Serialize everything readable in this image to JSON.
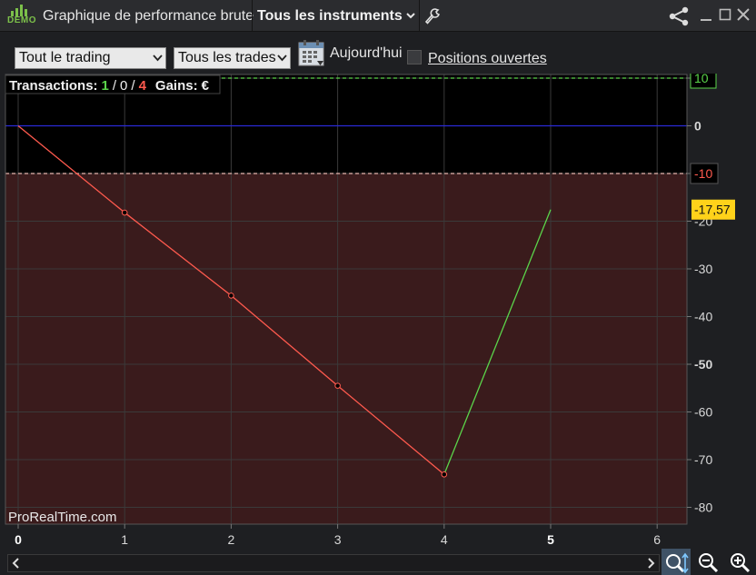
{
  "window": {
    "logo_text": "DEMO",
    "title": "Graphique de performance brute",
    "instrument": "Tous les instruments"
  },
  "toolbar": {
    "filter_trading": "Tout le trading",
    "filter_trades": "Tous les trades",
    "date_label": "Aujourd'hui",
    "open_positions_label": "Positions ouvertes"
  },
  "info": {
    "transactions_label": "Transactions:",
    "wins": "1",
    "slash1": "/",
    "neutral": "0",
    "slash2": "/",
    "losses": "4",
    "gains_label": "Gains:",
    "currency": "€"
  },
  "watermark": "ProRealTime.com",
  "colors": {
    "gain": "#5bd44a",
    "loss": "#ff5a4e",
    "chart_bg": "#000000",
    "loss_zone": "#3a1b1c",
    "baseline": "#2a2ad6",
    "current_badge": "#ffd21a"
  },
  "chart_data": {
    "type": "line",
    "x": [
      0,
      1,
      2,
      3,
      4,
      5
    ],
    "y": [
      0,
      -18.2,
      -35.6,
      -54.5,
      -73.1,
      -17.57
    ],
    "point_colors": [
      "loss",
      "loss",
      "loss",
      "loss",
      "gain"
    ],
    "xlim": [
      0,
      6.3
    ],
    "ylim": [
      -83,
      11
    ],
    "x_ticks": [
      "0",
      "1",
      "2",
      "3",
      "4",
      "5",
      "6"
    ],
    "x_bold_ticks": [
      "0",
      "5"
    ],
    "y_ticks": [
      "10",
      "0",
      "-10",
      "-20",
      "-30",
      "-40",
      "-50",
      "-60",
      "-70",
      "-80"
    ],
    "y_tick_values": [
      10,
      0,
      -10,
      -20,
      -30,
      -40,
      -50,
      -60,
      -70,
      -80
    ],
    "max_line": 10,
    "threshold_line": -10,
    "current_value": "-17,57",
    "current_value_num": -17.57
  }
}
